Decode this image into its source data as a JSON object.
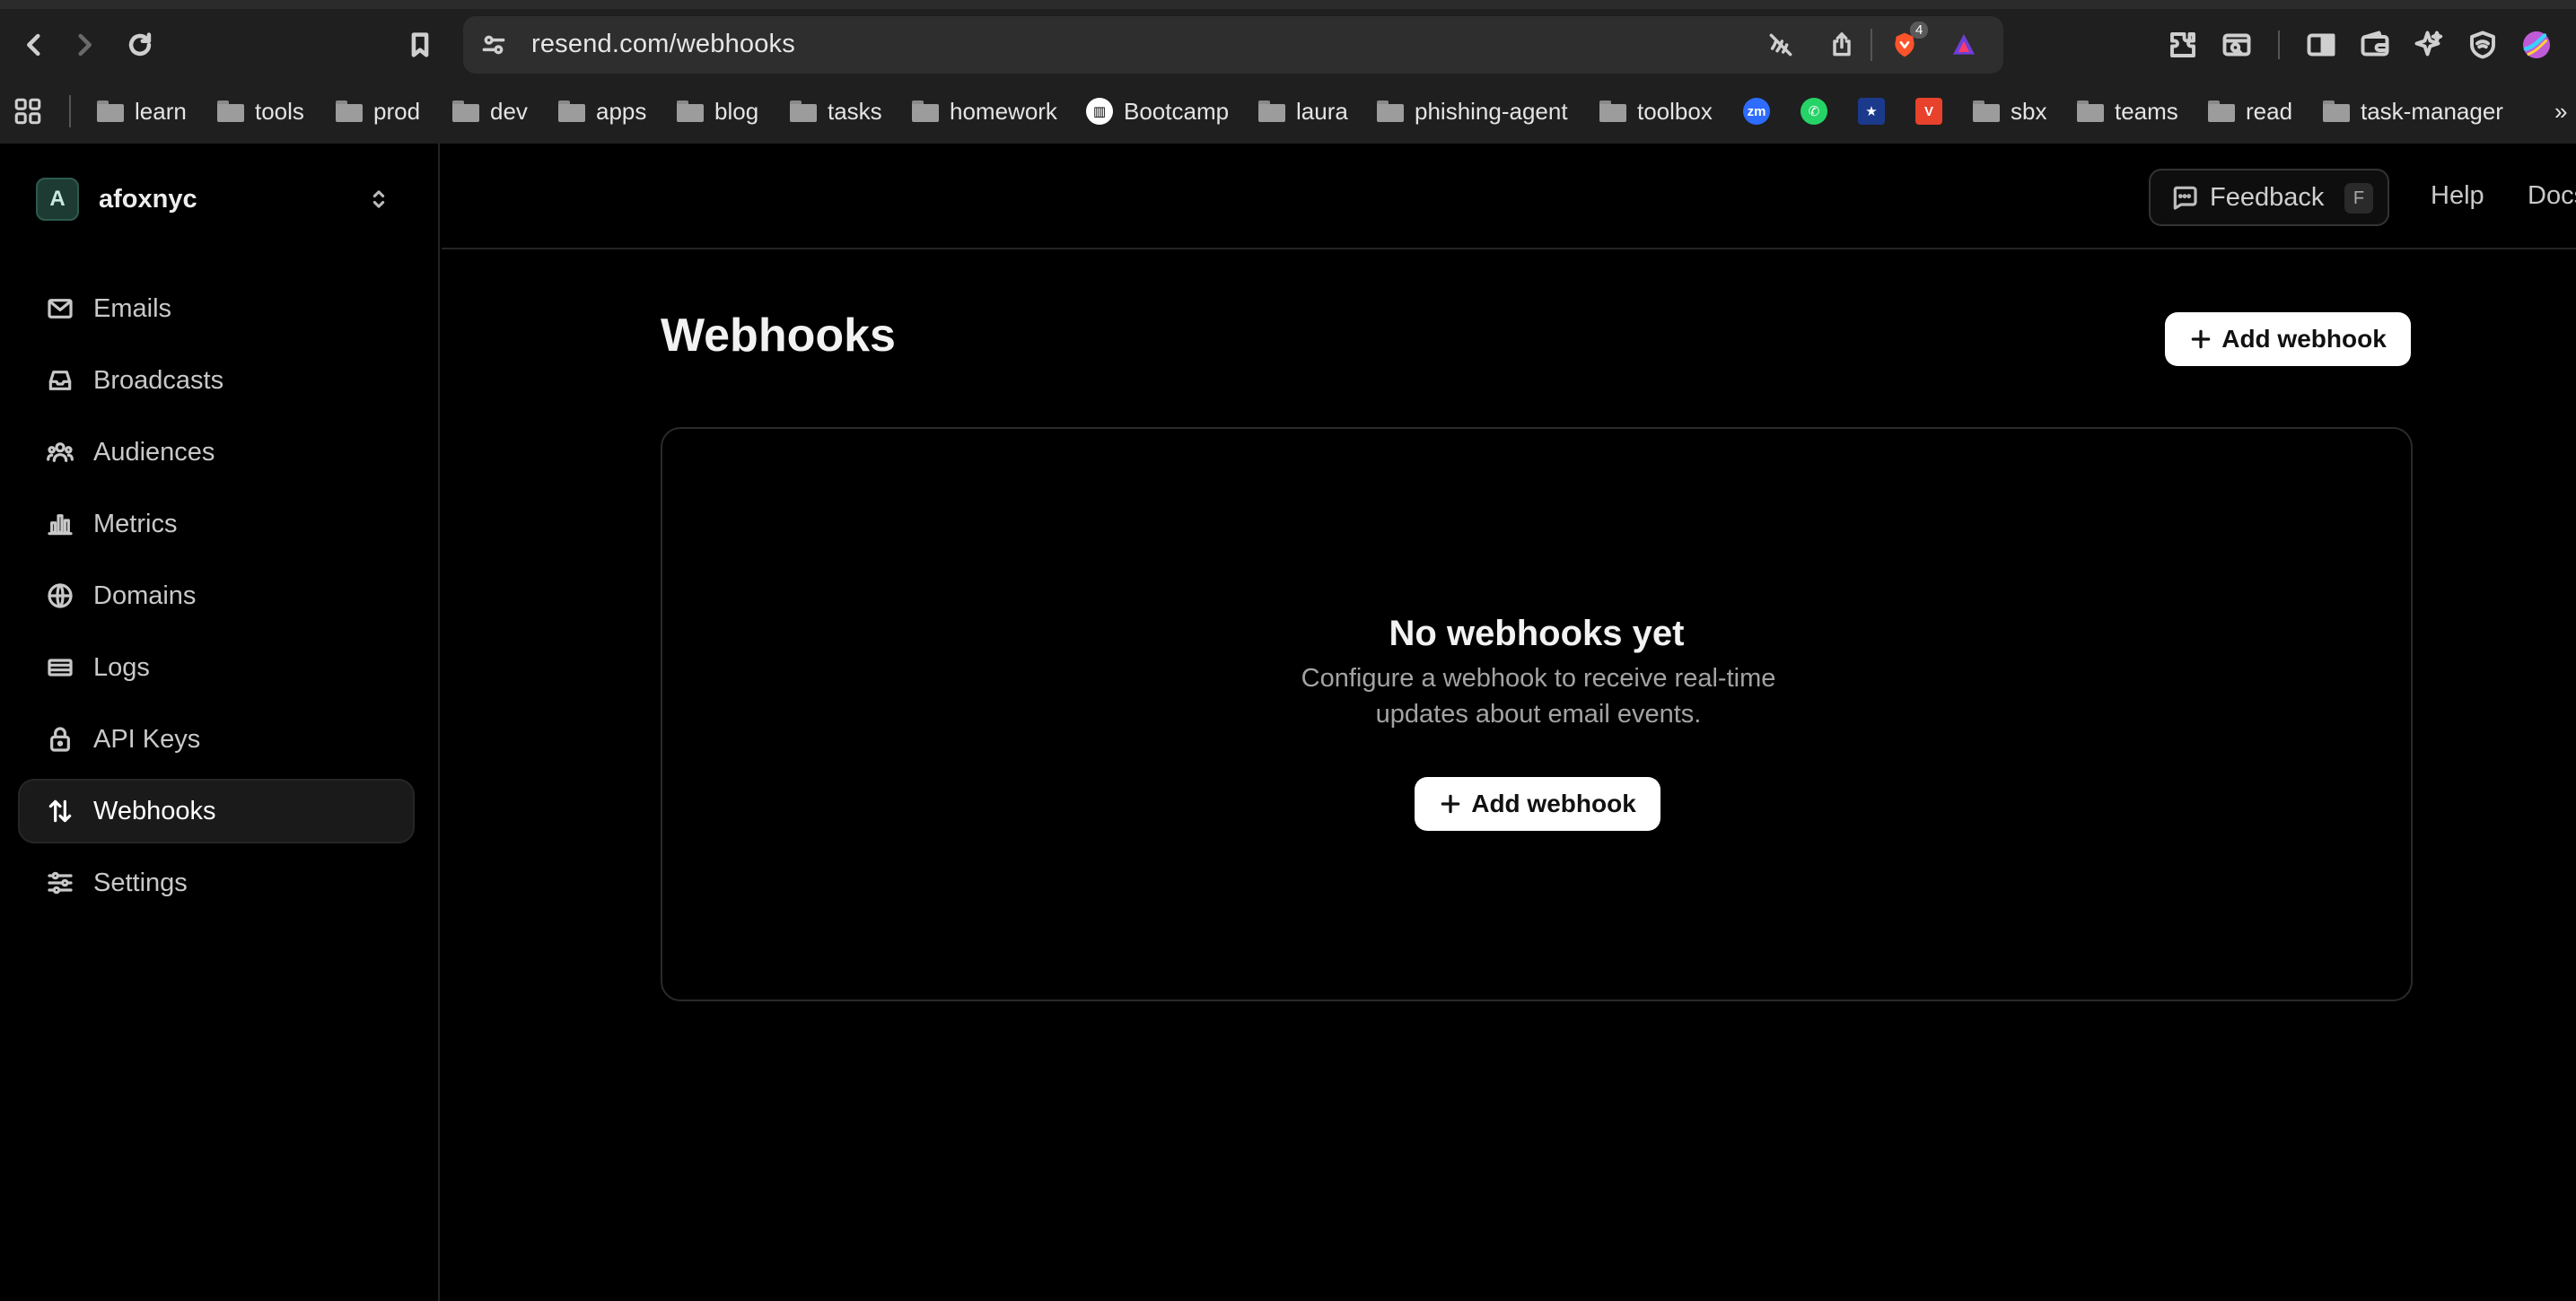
{
  "browser": {
    "url": "resend.com/webhooks",
    "shields_count": "4",
    "bookmarks": [
      {
        "label": "learn",
        "type": "folder"
      },
      {
        "label": "tools",
        "type": "folder"
      },
      {
        "label": "prod",
        "type": "folder"
      },
      {
        "label": "dev",
        "type": "folder"
      },
      {
        "label": "apps",
        "type": "folder"
      },
      {
        "label": "blog",
        "type": "folder"
      },
      {
        "label": "tasks",
        "type": "folder"
      },
      {
        "label": "homework",
        "type": "folder"
      },
      {
        "label": "Bootcamp",
        "type": "site"
      },
      {
        "label": "laura",
        "type": "folder"
      },
      {
        "label": "phishing-agent",
        "type": "folder"
      },
      {
        "label": "toolbox",
        "type": "folder"
      },
      {
        "label": "sbx",
        "type": "folder"
      },
      {
        "label": "teams",
        "type": "folder"
      },
      {
        "label": "read",
        "type": "folder"
      },
      {
        "label": "task-manager",
        "type": "folder"
      }
    ],
    "zoom_badge": "zm",
    "overflow": "»"
  },
  "team": {
    "initial": "A",
    "name": "afoxnyc"
  },
  "sidebar": {
    "items": [
      {
        "label": "Emails",
        "icon": "mail-icon"
      },
      {
        "label": "Broadcasts",
        "icon": "inbox-icon"
      },
      {
        "label": "Audiences",
        "icon": "users-icon"
      },
      {
        "label": "Metrics",
        "icon": "bar-chart-icon"
      },
      {
        "label": "Domains",
        "icon": "globe-icon"
      },
      {
        "label": "Logs",
        "icon": "logs-icon"
      },
      {
        "label": "API Keys",
        "icon": "lock-icon"
      },
      {
        "label": "Webhooks",
        "icon": "webhook-arrows-icon",
        "active": true
      },
      {
        "label": "Settings",
        "icon": "sliders-icon"
      }
    ]
  },
  "topbar": {
    "feedback_label": "Feedback",
    "feedback_shortcut": "F",
    "help_label": "Help",
    "docs_label": "Docs"
  },
  "main": {
    "title": "Webhooks",
    "add_button_label": "Add webhook",
    "empty_state": {
      "title": "No webhooks yet",
      "description": "Configure a webhook to receive real-time updates about email events.",
      "button_label": "Add webhook"
    }
  },
  "colors": {
    "background": "#000000",
    "sidebar_active": "#1a1a1a",
    "avatar_bg": "#1e3b33",
    "button_bg": "#ffffff"
  }
}
